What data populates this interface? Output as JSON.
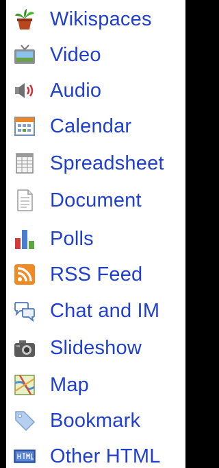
{
  "menu": {
    "items": [
      {
        "label": "Wikispaces",
        "icon": "potted-plant-icon"
      },
      {
        "label": "Video",
        "icon": "tv-icon"
      },
      {
        "label": "Audio",
        "icon": "speaker-icon"
      },
      {
        "label": "Calendar",
        "icon": "calendar-icon"
      },
      {
        "label": "Spreadsheet",
        "icon": "spreadsheet-icon"
      },
      {
        "label": "Document",
        "icon": "document-icon"
      },
      {
        "label": "Polls",
        "icon": "bar-chart-icon"
      },
      {
        "label": "RSS Feed",
        "icon": "rss-icon"
      },
      {
        "label": "Chat and IM",
        "icon": "chat-bubbles-icon"
      },
      {
        "label": "Slideshow",
        "icon": "camera-icon"
      },
      {
        "label": "Map",
        "icon": "map-icon"
      },
      {
        "label": "Bookmark",
        "icon": "tag-icon"
      },
      {
        "label": "Other HTML",
        "icon": "html-badge-icon"
      }
    ]
  },
  "colors": {
    "link": "#1f3fd0",
    "background": "#ffffff",
    "frame": "#000000"
  }
}
